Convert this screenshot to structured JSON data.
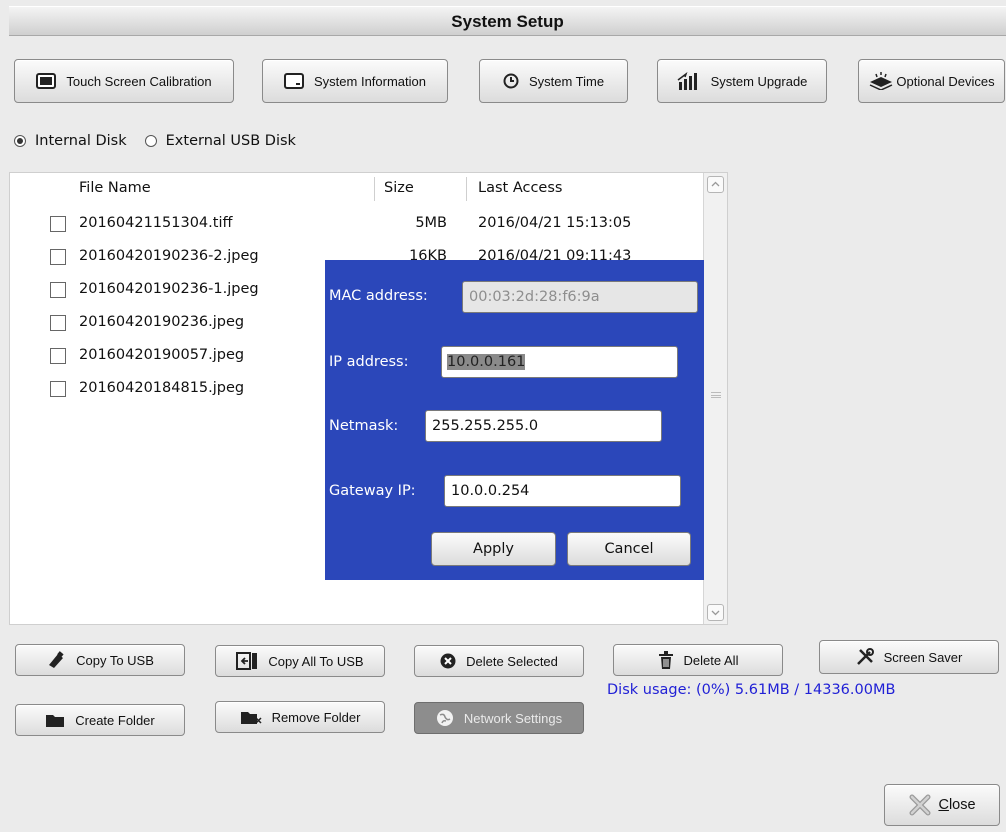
{
  "window": {
    "title": "System Setup"
  },
  "toolbar": {
    "touch_calibration": "Touch Screen Calibration",
    "system_information": "System Information",
    "system_time": "System Time",
    "system_upgrade": "System Upgrade",
    "optional_devices": "Optional Devices"
  },
  "disk_select": {
    "internal": "Internal Disk",
    "external": "External USB Disk",
    "selected": "internal"
  },
  "file_table": {
    "columns": [
      "File Name",
      "Size",
      "Last Access"
    ],
    "rows": [
      {
        "name": "20160421151304.tiff",
        "size": "5MB",
        "date": "2016/04/21 15:13:05",
        "checked": false
      },
      {
        "name": "20160420190236-2.jpeg",
        "size": "16KB",
        "date": "2016/04/21 09:11:43",
        "checked": false
      },
      {
        "name": "20160420190236-1.jpeg",
        "size": "",
        "date": "",
        "checked": false
      },
      {
        "name": "20160420190236.jpeg",
        "size": "",
        "date": "",
        "checked": false
      },
      {
        "name": "20160420190057.jpeg",
        "size": "",
        "date": "",
        "checked": false
      },
      {
        "name": "20160420184815.jpeg",
        "size": "",
        "date": "",
        "checked": false
      }
    ]
  },
  "network_dialog": {
    "mac_label": "MAC address:",
    "mac_value": "00:03:2d:28:f6:9a",
    "ip_label": "IP address:",
    "ip_value": "10.0.0.161",
    "netmask_label": "Netmask:",
    "netmask_value": "255.255.255.0",
    "gateway_label": "Gateway IP:",
    "gateway_value": "10.0.0.254",
    "apply": "Apply",
    "cancel": "Cancel",
    "background": "#2b47ba"
  },
  "actions": {
    "copy_to_usb": "Copy To USB",
    "copy_all_to_usb": "Copy All To USB",
    "delete_selected": "Delete Selected",
    "delete_all": "Delete All",
    "screen_saver": "Screen Saver",
    "create_folder": "Create Folder",
    "remove_folder": "Remove Folder",
    "network_settings": "Network Settings"
  },
  "status": {
    "disk_usage": "Disk usage: (0%) 5.61MB / 14336.00MB",
    "color": "#2121d6"
  },
  "footer": {
    "close_mnemonic": "C",
    "close_rest": "lose"
  }
}
